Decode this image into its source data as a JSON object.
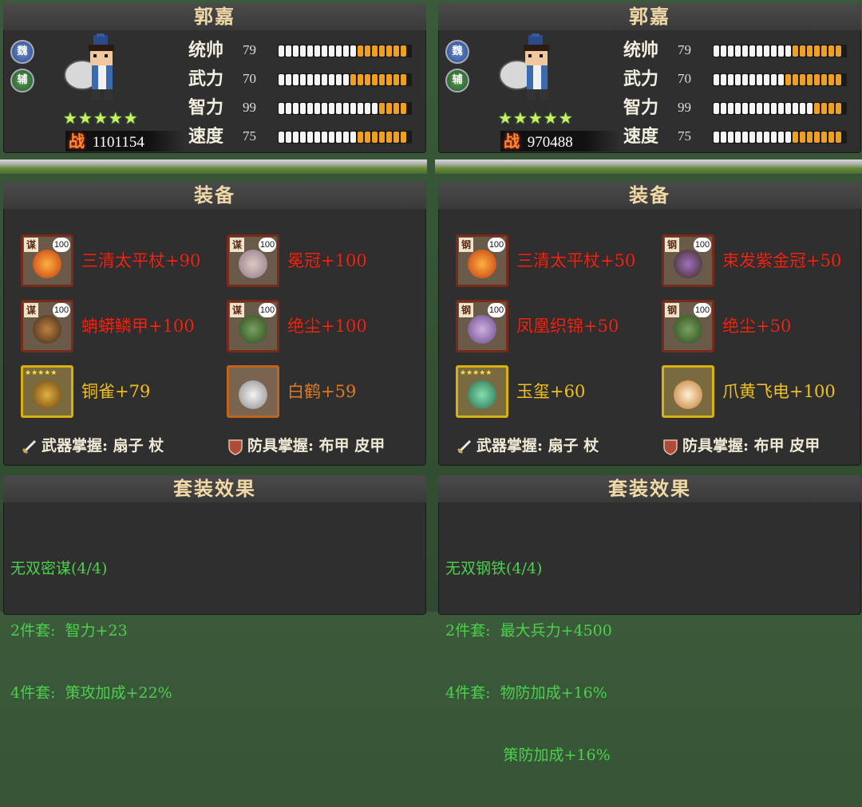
{
  "panels": [
    {
      "hero": {
        "name": "郭嘉",
        "badges": [
          "魏",
          "辅"
        ],
        "stars": "★★★★★",
        "power_label": "战",
        "power": "1101154",
        "stats": [
          {
            "label": "统帅",
            "value": "79",
            "fill": 0.79
          },
          {
            "label": "武力",
            "value": "70",
            "fill": 0.7
          },
          {
            "label": "智力",
            "value": "99",
            "fill": 0.99
          },
          {
            "label": "速度",
            "value": "75",
            "fill": 0.75
          }
        ]
      },
      "equipment": {
        "title": "装备",
        "items": [
          {
            "tag": "谋",
            "level": "100",
            "name": "三清太平杖+90",
            "color": "red"
          },
          {
            "tag": "谋",
            "level": "100",
            "name": "冕冠+100",
            "color": "red"
          },
          {
            "tag": "谋",
            "level": "100",
            "name": "蚺蟒鳞甲+100",
            "color": "red"
          },
          {
            "tag": "谋",
            "level": "100",
            "name": "绝尘+100",
            "color": "red"
          },
          {
            "tag": "",
            "level": "",
            "name": "铜雀+79",
            "color": "yellow"
          },
          {
            "tag": "",
            "level": "",
            "name": "白鹤+59",
            "color": "orange"
          }
        ],
        "weapon_mastery": "武器掌握: 扇子 杖",
        "armor_mastery": "防具掌握: 布甲 皮甲"
      },
      "set": {
        "title": "套装效果",
        "lines": [
          "无双密谋(4/4)",
          "2件套:  智力+23",
          "4件套:  策攻加成+22%"
        ]
      }
    },
    {
      "hero": {
        "name": "郭嘉",
        "badges": [
          "魏",
          "辅"
        ],
        "stars": "★★★★★",
        "power_label": "战",
        "power": "970488",
        "stats": [
          {
            "label": "统帅",
            "value": "79",
            "fill": 0.79
          },
          {
            "label": "武力",
            "value": "70",
            "fill": 0.7
          },
          {
            "label": "智力",
            "value": "99",
            "fill": 0.99
          },
          {
            "label": "速度",
            "value": "75",
            "fill": 0.75
          }
        ]
      },
      "equipment": {
        "title": "装备",
        "items": [
          {
            "tag": "钢",
            "level": "100",
            "name": "三清太平杖+50",
            "color": "red"
          },
          {
            "tag": "钢",
            "level": "100",
            "name": "束发紫金冠+50",
            "color": "red"
          },
          {
            "tag": "钢",
            "level": "100",
            "name": "凤凰织锦+50",
            "color": "red"
          },
          {
            "tag": "钢",
            "level": "100",
            "name": "绝尘+50",
            "color": "red"
          },
          {
            "tag": "",
            "level": "",
            "name": "玉玺+60",
            "color": "yellow"
          },
          {
            "tag": "",
            "level": "",
            "name": "爪黄飞电+100",
            "color": "yellow"
          }
        ],
        "weapon_mastery": "武器掌握: 扇子 杖",
        "armor_mastery": "防具掌握: 布甲 皮甲"
      },
      "set": {
        "title": "套装效果",
        "lines": [
          "无双钢铁(4/4)",
          "2件套:  最大兵力+4500",
          "4件套:  物防加成+16%",
          "            策防加成+16%"
        ]
      }
    }
  ]
}
